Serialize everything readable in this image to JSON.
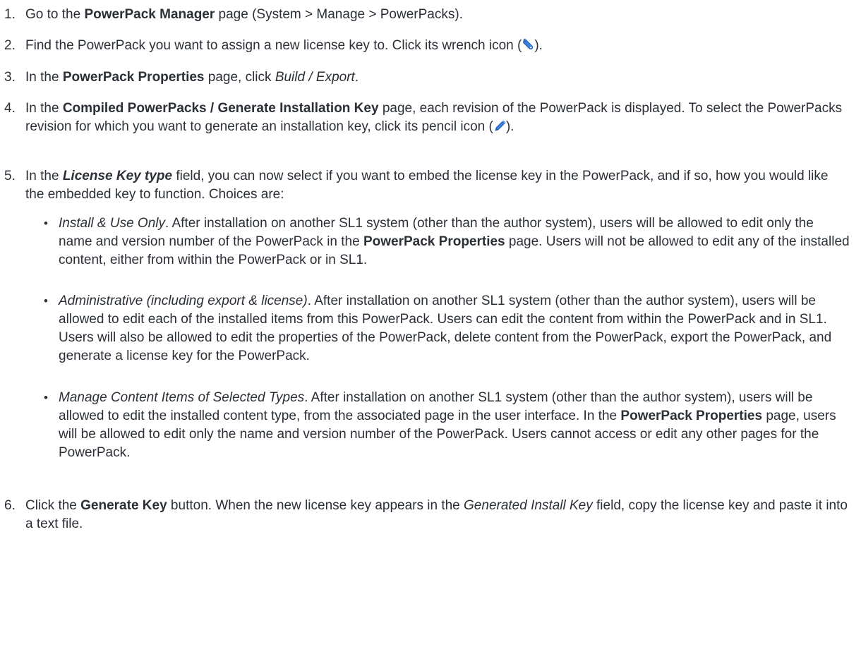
{
  "steps": [
    {
      "num": "1.",
      "t1": "Go to the ",
      "b1": "PowerPack Manager",
      "t2": " page (System > Manage > PowerPacks)."
    },
    {
      "num": "2.",
      "t1": "Find the PowerPack you want to assign a new license key to. Click its wrench icon (",
      "icon": "wrench-icon",
      "t2": ")."
    },
    {
      "num": "3.",
      "t1": "In the ",
      "b1": "PowerPack Properties",
      "t2": " page, click ",
      "i1": "Build / Export",
      "t3": "."
    },
    {
      "num": "4.",
      "t1": "In the ",
      "b1": "Compiled PowerPacks / Generate Installation Key",
      "t2": " page, each revision of the PowerPack is displayed. To select the PowerPacks revision for which you want to generate an installation key, click its pencil icon (",
      "icon": "pencil-icon",
      "t3": ")."
    },
    {
      "num": "5.",
      "t1": "In the ",
      "bi1": "License Key type",
      "t2": " field, you can now select if you want to embed the license key in the PowerPack, and if so, how you would like the embedded key to function. Choices are:",
      "bullets": [
        {
          "dot": "•",
          "i1": "Install & Use Only",
          "t1": ". After installation on another SL1 system (other than the author system), users will be allowed to edit only the name and version number of the PowerPack in the ",
          "b1": "PowerPack Properties",
          "t2": " page. Users will not be allowed to edit any of the installed content, either from within the PowerPack or in SL1."
        },
        {
          "dot": "•",
          "i1": "Administrative (including export & license)",
          "t1": ". After installation on another SL1 system (other than the author system), users will be allowed to edit each of the installed items from this PowerPack. Users can edit the content from within the PowerPack and in SL1. Users will also be allowed to edit the properties of the PowerPack, delete content from the PowerPack, export the PowerPack, and generate a license key for the PowerPack."
        },
        {
          "dot": "•",
          "i1": "Manage Content Items of Selected Types",
          "t1": ". After installation on another SL1 system (other than the author system), users will be allowed to edit the installed content type, from the associated page in the user interface. In the ",
          "b1": "PowerPack Properties",
          "t2": " page, users will be allowed to edit only the name and version number of the PowerPack. Users cannot access or edit any other pages for the PowerPack."
        }
      ]
    },
    {
      "num": "6.",
      "t1": "Click the ",
      "b1": "Generate Key",
      "t2": " button. When the new license key appears in the ",
      "i1": "Generated Install Key",
      "t3": " field, copy the license key and paste it into a text file."
    }
  ],
  "colors": {
    "text": "#2b2f36",
    "icon_blue": "#3d7fd6"
  }
}
